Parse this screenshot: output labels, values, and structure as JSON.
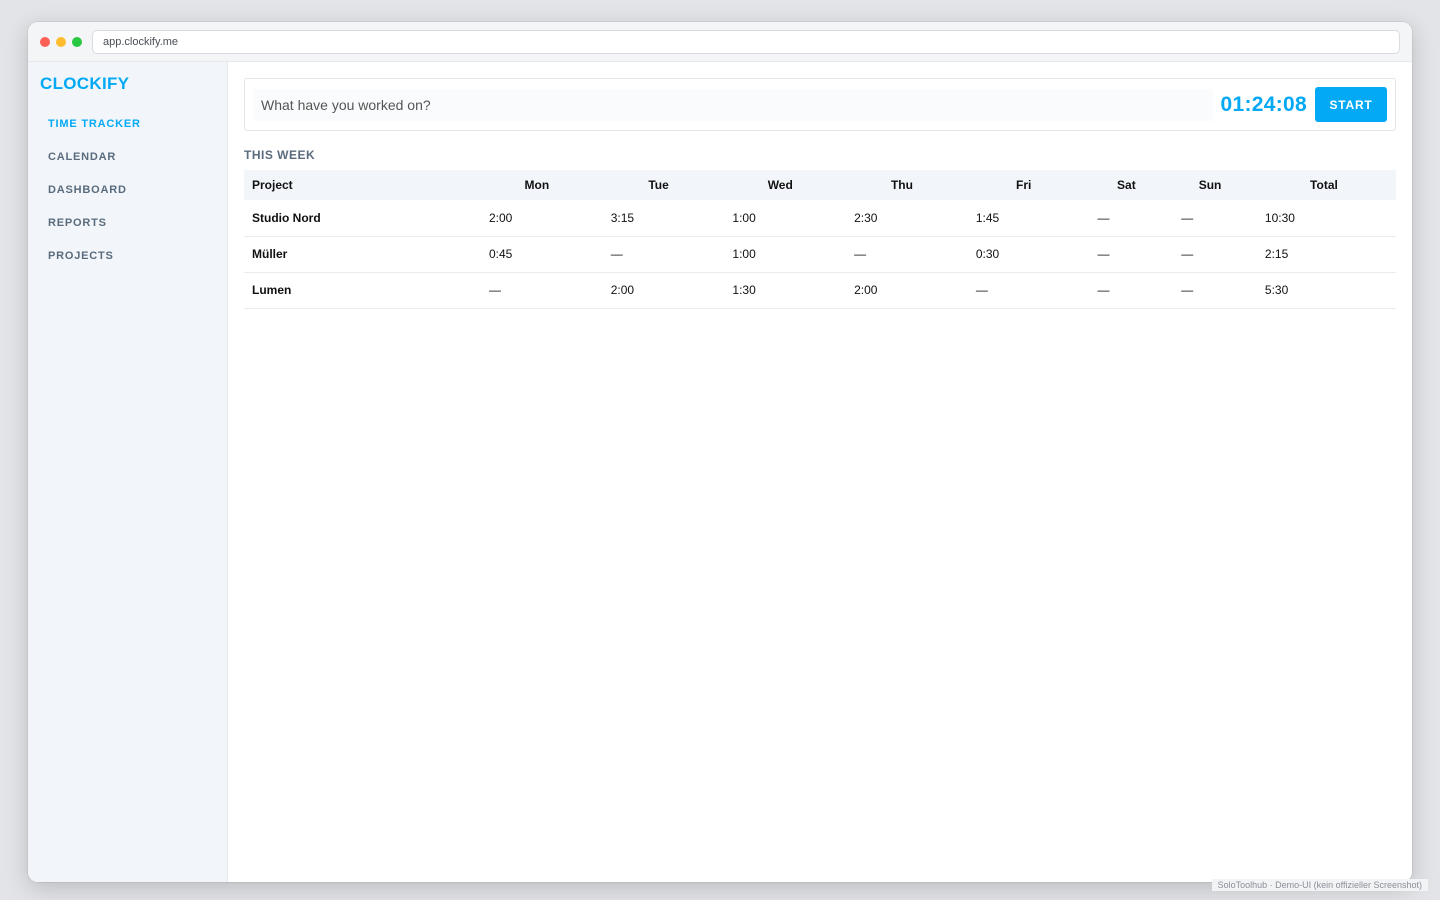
{
  "browser": {
    "url": "app.clockify.me"
  },
  "sidebar": {
    "brand": "CLOCKIFY",
    "items": [
      {
        "label": "TIME TRACKER",
        "active": true
      },
      {
        "label": "CALENDAR",
        "active": false
      },
      {
        "label": "DASHBOARD",
        "active": false
      },
      {
        "label": "REPORTS",
        "active": false
      },
      {
        "label": "PROJECTS",
        "active": false
      }
    ]
  },
  "tracker": {
    "placeholder": "What have you worked on?",
    "timer": "01:24:08",
    "start_label": "START"
  },
  "week": {
    "title": "THIS WEEK",
    "headers": [
      "Project",
      "Mon",
      "Tue",
      "Wed",
      "Thu",
      "Fri",
      "Sat",
      "Sun",
      "Total"
    ],
    "rows": [
      {
        "project": "Studio Nord",
        "cells": [
          "2:00",
          "3:15",
          "1:00",
          "2:30",
          "1:45",
          "—",
          "—",
          "10:30"
        ]
      },
      {
        "project": "Müller",
        "cells": [
          "0:45",
          "—",
          "1:00",
          "—",
          "0:30",
          "—",
          "—",
          "2:15"
        ]
      },
      {
        "project": "Lumen",
        "cells": [
          "—",
          "2:00",
          "1:30",
          "2:00",
          "—",
          "—",
          "—",
          "5:30"
        ]
      }
    ]
  },
  "footer": {
    "watermark": "SoloToolhub · Demo-UI (kein offizieller Screenshot)"
  },
  "colors": {
    "accent": "#03a9f4",
    "sidebar_bg": "#f2f6fa",
    "muted_text": "#5a6b7d"
  }
}
